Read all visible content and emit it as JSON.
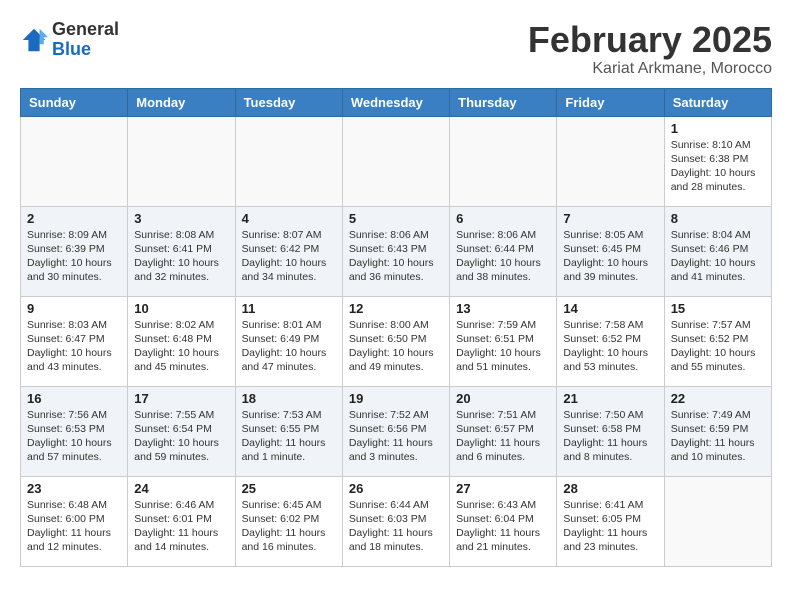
{
  "header": {
    "logo_line1": "General",
    "logo_line2": "Blue",
    "month_title": "February 2025",
    "location": "Kariat Arkmane, Morocco"
  },
  "weekdays": [
    "Sunday",
    "Monday",
    "Tuesday",
    "Wednesday",
    "Thursday",
    "Friday",
    "Saturday"
  ],
  "weeks": [
    [
      {
        "day": "",
        "info": ""
      },
      {
        "day": "",
        "info": ""
      },
      {
        "day": "",
        "info": ""
      },
      {
        "day": "",
        "info": ""
      },
      {
        "day": "",
        "info": ""
      },
      {
        "day": "",
        "info": ""
      },
      {
        "day": "1",
        "info": "Sunrise: 8:10 AM\nSunset: 6:38 PM\nDaylight: 10 hours and 28 minutes."
      }
    ],
    [
      {
        "day": "2",
        "info": "Sunrise: 8:09 AM\nSunset: 6:39 PM\nDaylight: 10 hours and 30 minutes."
      },
      {
        "day": "3",
        "info": "Sunrise: 8:08 AM\nSunset: 6:41 PM\nDaylight: 10 hours and 32 minutes."
      },
      {
        "day": "4",
        "info": "Sunrise: 8:07 AM\nSunset: 6:42 PM\nDaylight: 10 hours and 34 minutes."
      },
      {
        "day": "5",
        "info": "Sunrise: 8:06 AM\nSunset: 6:43 PM\nDaylight: 10 hours and 36 minutes."
      },
      {
        "day": "6",
        "info": "Sunrise: 8:06 AM\nSunset: 6:44 PM\nDaylight: 10 hours and 38 minutes."
      },
      {
        "day": "7",
        "info": "Sunrise: 8:05 AM\nSunset: 6:45 PM\nDaylight: 10 hours and 39 minutes."
      },
      {
        "day": "8",
        "info": "Sunrise: 8:04 AM\nSunset: 6:46 PM\nDaylight: 10 hours and 41 minutes."
      }
    ],
    [
      {
        "day": "9",
        "info": "Sunrise: 8:03 AM\nSunset: 6:47 PM\nDaylight: 10 hours and 43 minutes."
      },
      {
        "day": "10",
        "info": "Sunrise: 8:02 AM\nSunset: 6:48 PM\nDaylight: 10 hours and 45 minutes."
      },
      {
        "day": "11",
        "info": "Sunrise: 8:01 AM\nSunset: 6:49 PM\nDaylight: 10 hours and 47 minutes."
      },
      {
        "day": "12",
        "info": "Sunrise: 8:00 AM\nSunset: 6:50 PM\nDaylight: 10 hours and 49 minutes."
      },
      {
        "day": "13",
        "info": "Sunrise: 7:59 AM\nSunset: 6:51 PM\nDaylight: 10 hours and 51 minutes."
      },
      {
        "day": "14",
        "info": "Sunrise: 7:58 AM\nSunset: 6:52 PM\nDaylight: 10 hours and 53 minutes."
      },
      {
        "day": "15",
        "info": "Sunrise: 7:57 AM\nSunset: 6:52 PM\nDaylight: 10 hours and 55 minutes."
      }
    ],
    [
      {
        "day": "16",
        "info": "Sunrise: 7:56 AM\nSunset: 6:53 PM\nDaylight: 10 hours and 57 minutes."
      },
      {
        "day": "17",
        "info": "Sunrise: 7:55 AM\nSunset: 6:54 PM\nDaylight: 10 hours and 59 minutes."
      },
      {
        "day": "18",
        "info": "Sunrise: 7:53 AM\nSunset: 6:55 PM\nDaylight: 11 hours and 1 minute."
      },
      {
        "day": "19",
        "info": "Sunrise: 7:52 AM\nSunset: 6:56 PM\nDaylight: 11 hours and 3 minutes."
      },
      {
        "day": "20",
        "info": "Sunrise: 7:51 AM\nSunset: 6:57 PM\nDaylight: 11 hours and 6 minutes."
      },
      {
        "day": "21",
        "info": "Sunrise: 7:50 AM\nSunset: 6:58 PM\nDaylight: 11 hours and 8 minutes."
      },
      {
        "day": "22",
        "info": "Sunrise: 7:49 AM\nSunset: 6:59 PM\nDaylight: 11 hours and 10 minutes."
      }
    ],
    [
      {
        "day": "23",
        "info": "Sunrise: 6:48 AM\nSunset: 6:00 PM\nDaylight: 11 hours and 12 minutes."
      },
      {
        "day": "24",
        "info": "Sunrise: 6:46 AM\nSunset: 6:01 PM\nDaylight: 11 hours and 14 minutes."
      },
      {
        "day": "25",
        "info": "Sunrise: 6:45 AM\nSunset: 6:02 PM\nDaylight: 11 hours and 16 minutes."
      },
      {
        "day": "26",
        "info": "Sunrise: 6:44 AM\nSunset: 6:03 PM\nDaylight: 11 hours and 18 minutes."
      },
      {
        "day": "27",
        "info": "Sunrise: 6:43 AM\nSunset: 6:04 PM\nDaylight: 11 hours and 21 minutes."
      },
      {
        "day": "28",
        "info": "Sunrise: 6:41 AM\nSunset: 6:05 PM\nDaylight: 11 hours and 23 minutes."
      },
      {
        "day": "",
        "info": ""
      }
    ]
  ]
}
